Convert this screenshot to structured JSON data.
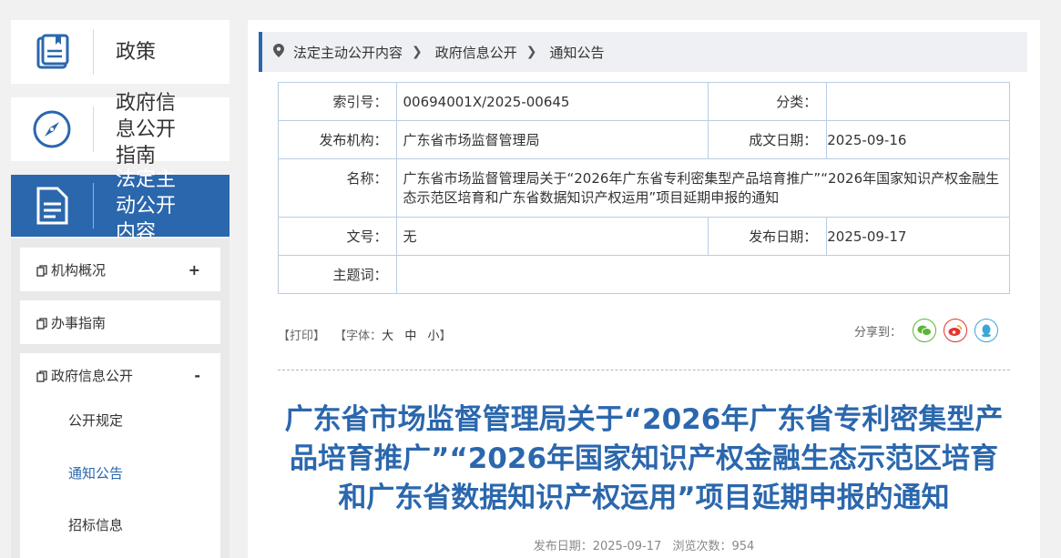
{
  "sidebar": {
    "cards": [
      {
        "label": "政策"
      },
      {
        "label": "政府信息公开指南"
      },
      {
        "label": "法定主动公开内容"
      }
    ],
    "menu": [
      {
        "label": "机构概况",
        "toggle": "+"
      },
      {
        "label": "办事指南"
      },
      {
        "label": "政府信息公开",
        "toggle": "-"
      }
    ],
    "submenu": [
      {
        "label": "公开规定"
      },
      {
        "label": "通知公告"
      },
      {
        "label": "招标信息"
      }
    ]
  },
  "breadcrumb": [
    "法定主动公开内容",
    "政府信息公开",
    "通知公告"
  ],
  "meta": {
    "index_label": "索引号：",
    "index_value": "00694001X/2025-00645",
    "category_label": "分类：",
    "category_value": "",
    "publisher_label": "发布机构：",
    "publisher_value": "广东省市场监督管理局",
    "created_label": "成文日期：",
    "created_value": "2025-09-16",
    "name_label": "名称：",
    "name_value": "广东省市场监督管理局关于“2026年广东省专利密集型产品培育推广”“2026年国家知识产权金融生态示范区培育和广东省数据知识产权运用”项目延期申报的通知",
    "docno_label": "文号：",
    "docno_value": "无",
    "pubdate_label": "发布日期：",
    "pubdate_value": "2025-09-17",
    "subject_label": "主题词：",
    "subject_value": ""
  },
  "tools": {
    "print": "【打印】",
    "font_prefix": "【字体：",
    "large": "大",
    "medium": "中",
    "small": "小",
    "font_suffix": "】"
  },
  "share": {
    "label": "分享到："
  },
  "article": {
    "title": "广东省市场监督管理局关于“2026年广东省专利密集型产品培育推广”“2026年国家知识产权金融生态示范区培育和广东省数据知识产权运用”项目延期申报的通知",
    "pub_label": "发布日期：",
    "pub_date": "2025-09-17",
    "views_label": "浏览次数：",
    "views": "954"
  },
  "colors": {
    "accent": "#2b67ad",
    "wechat": "#5ab534",
    "weibo": "#e6322b",
    "qq": "#3ba6d9"
  }
}
